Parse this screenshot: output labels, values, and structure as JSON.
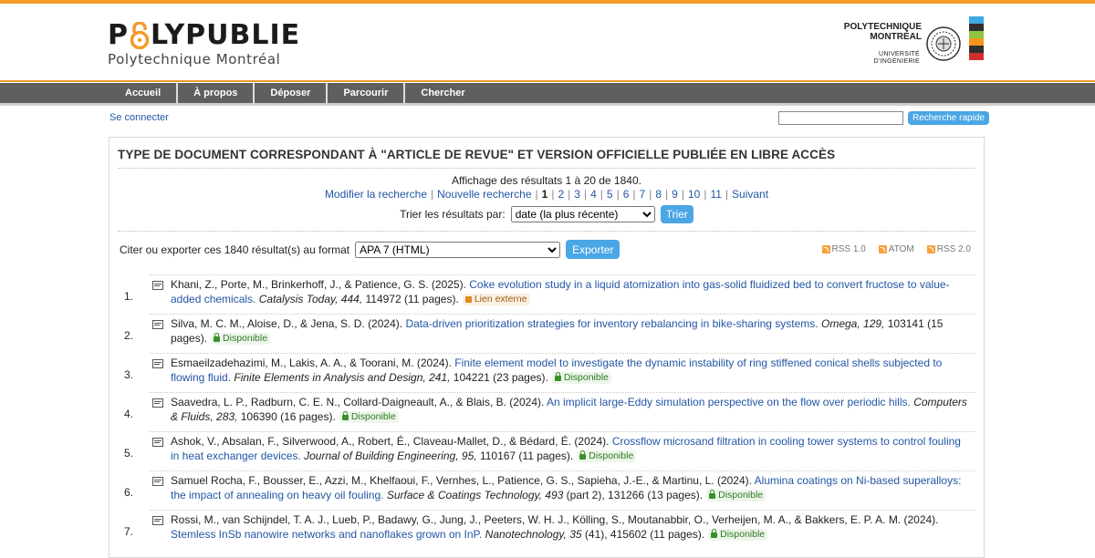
{
  "header": {
    "logo_main_left": "P",
    "logo_main_right": "LYPUBLIE",
    "logo_sub": "Polytechnique Montréal",
    "partner_line1": "POLYTECHNIQUE",
    "partner_line2": "MONTRÉAL",
    "partner_small1": "UNIVERSITÉ",
    "partner_small2": "D'INGÉNIERIE",
    "bar_colors": [
      "#3fa9e1",
      "#2f2f2f",
      "#8cc63f",
      "#f7941d",
      "#2f2f2f",
      "#d12f2f"
    ]
  },
  "menu": [
    "Accueil",
    "À propos",
    "Déposer",
    "Parcourir",
    "Chercher"
  ],
  "login": "Se connecter",
  "quick_search": {
    "button": "Recherche rapide",
    "value": ""
  },
  "panel": {
    "title": "TYPE DE DOCUMENT CORRESPONDANT À \"ARTICLE DE REVUE\" ET VERSION OFFICIELLE PUBLIÉE EN LIBRE ACCÈS",
    "summary": "Affichage des résultats 1 à 20 de 1840.",
    "modify": "Modifier la recherche",
    "new_search": "Nouvelle recherche",
    "pages": [
      "1",
      "2",
      "3",
      "4",
      "5",
      "6",
      "7",
      "8",
      "9",
      "10",
      "11"
    ],
    "current_page": "1",
    "next": "Suivant",
    "sort_label": "Trier les résultats par:",
    "sort_value": "date (la plus récente)",
    "sort_button": "Trier",
    "export_label": "Citer ou exporter ces 1840 résultat(s) au format",
    "export_value": "APA 7 (HTML)",
    "export_button": "Exporter",
    "feeds": [
      "RSS 1.0",
      "ATOM",
      "RSS 2.0"
    ]
  },
  "results": [
    {
      "num": "1.",
      "authors": "Khani, Z., Porte, M., Brinkerhoff, J., & Patience, G. S. (2025).",
      "title": "Coke evolution study in a liquid atomization into gas-solid fluidized bed to convert fructose to value-added chemicals.",
      "journal": "Catalysis Today,",
      "volume": "444,",
      "rest": "114972 (11 pages).",
      "badge": "Lien externe",
      "badge_type": "ext"
    },
    {
      "num": "2.",
      "authors": "Silva, M. C. M., Aloise, D., & Jena, S. D. (2024).",
      "title": "Data-driven prioritization strategies for inventory rebalancing in bike-sharing systems.",
      "journal": "Omega,",
      "volume": "129,",
      "rest": "103141 (15 pages).",
      "badge": "Disponible",
      "badge_type": "ok"
    },
    {
      "num": "3.",
      "authors": "Esmaeilzadehazimi, M., Lakis, A. A., & Toorani, M. (2024).",
      "title": "Finite element model to investigate the dynamic instability of ring stiffened conical shells subjected to flowing fluid.",
      "journal": "Finite Elements in Analysis and Design,",
      "volume": "241,",
      "rest": "104221 (23 pages).",
      "badge": "Disponible",
      "badge_type": "ok"
    },
    {
      "num": "4.",
      "authors": "Saavedra, L. P., Radburn, C. E. N., Collard-Daigneault, A., & Blais, B. (2024).",
      "title": "An implicit large-Eddy simulation perspective on the flow over periodic hills.",
      "journal": "Computers & Fluids,",
      "volume": "283,",
      "rest": "106390 (16 pages).",
      "badge": "Disponible",
      "badge_type": "ok"
    },
    {
      "num": "5.",
      "authors": "Ashok, V., Absalan, F., Silverwood, A., Robert, É., Claveau-Mallet, D., & Bédard, É. (2024).",
      "title": "Crossflow microsand filtration in cooling tower systems to control fouling in heat exchanger devices.",
      "journal": "Journal of Building Engineering,",
      "volume": "95,",
      "rest": "110167 (11 pages).",
      "badge": "Disponible",
      "badge_type": "ok"
    },
    {
      "num": "6.",
      "authors": "Samuel Rocha, F., Bousser, E., Azzi, M., Khelfaoui, F., Vernhes, L., Patience, G. S., Sapieha, J.-E., & Martinu, L. (2024).",
      "title": "Alumina coatings on Ni-based superalloys: the impact of annealing on heavy oil fouling.",
      "journal": "Surface & Coatings Technology,",
      "volume": "493",
      "rest": "(part 2), 131266 (13 pages).",
      "badge": "Disponible",
      "badge_type": "ok"
    },
    {
      "num": "7.",
      "authors": "Rossi, M., van Schijndel, T. A. J., Lueb, P., Badawy, G., Jung, J., Peeters, W. H. J., Kölling, S., Moutanabbir, O., Verheijen, M. A., & Bakkers, E. P. A. M. (2024).",
      "title": "Stemless InSb nanowire networks and nanoflakes grown on InP.",
      "journal": "Nanotechnology,",
      "volume": "35",
      "rest": "(41), 415602 (11 pages).",
      "badge": "Disponible",
      "badge_type": "ok"
    }
  ]
}
